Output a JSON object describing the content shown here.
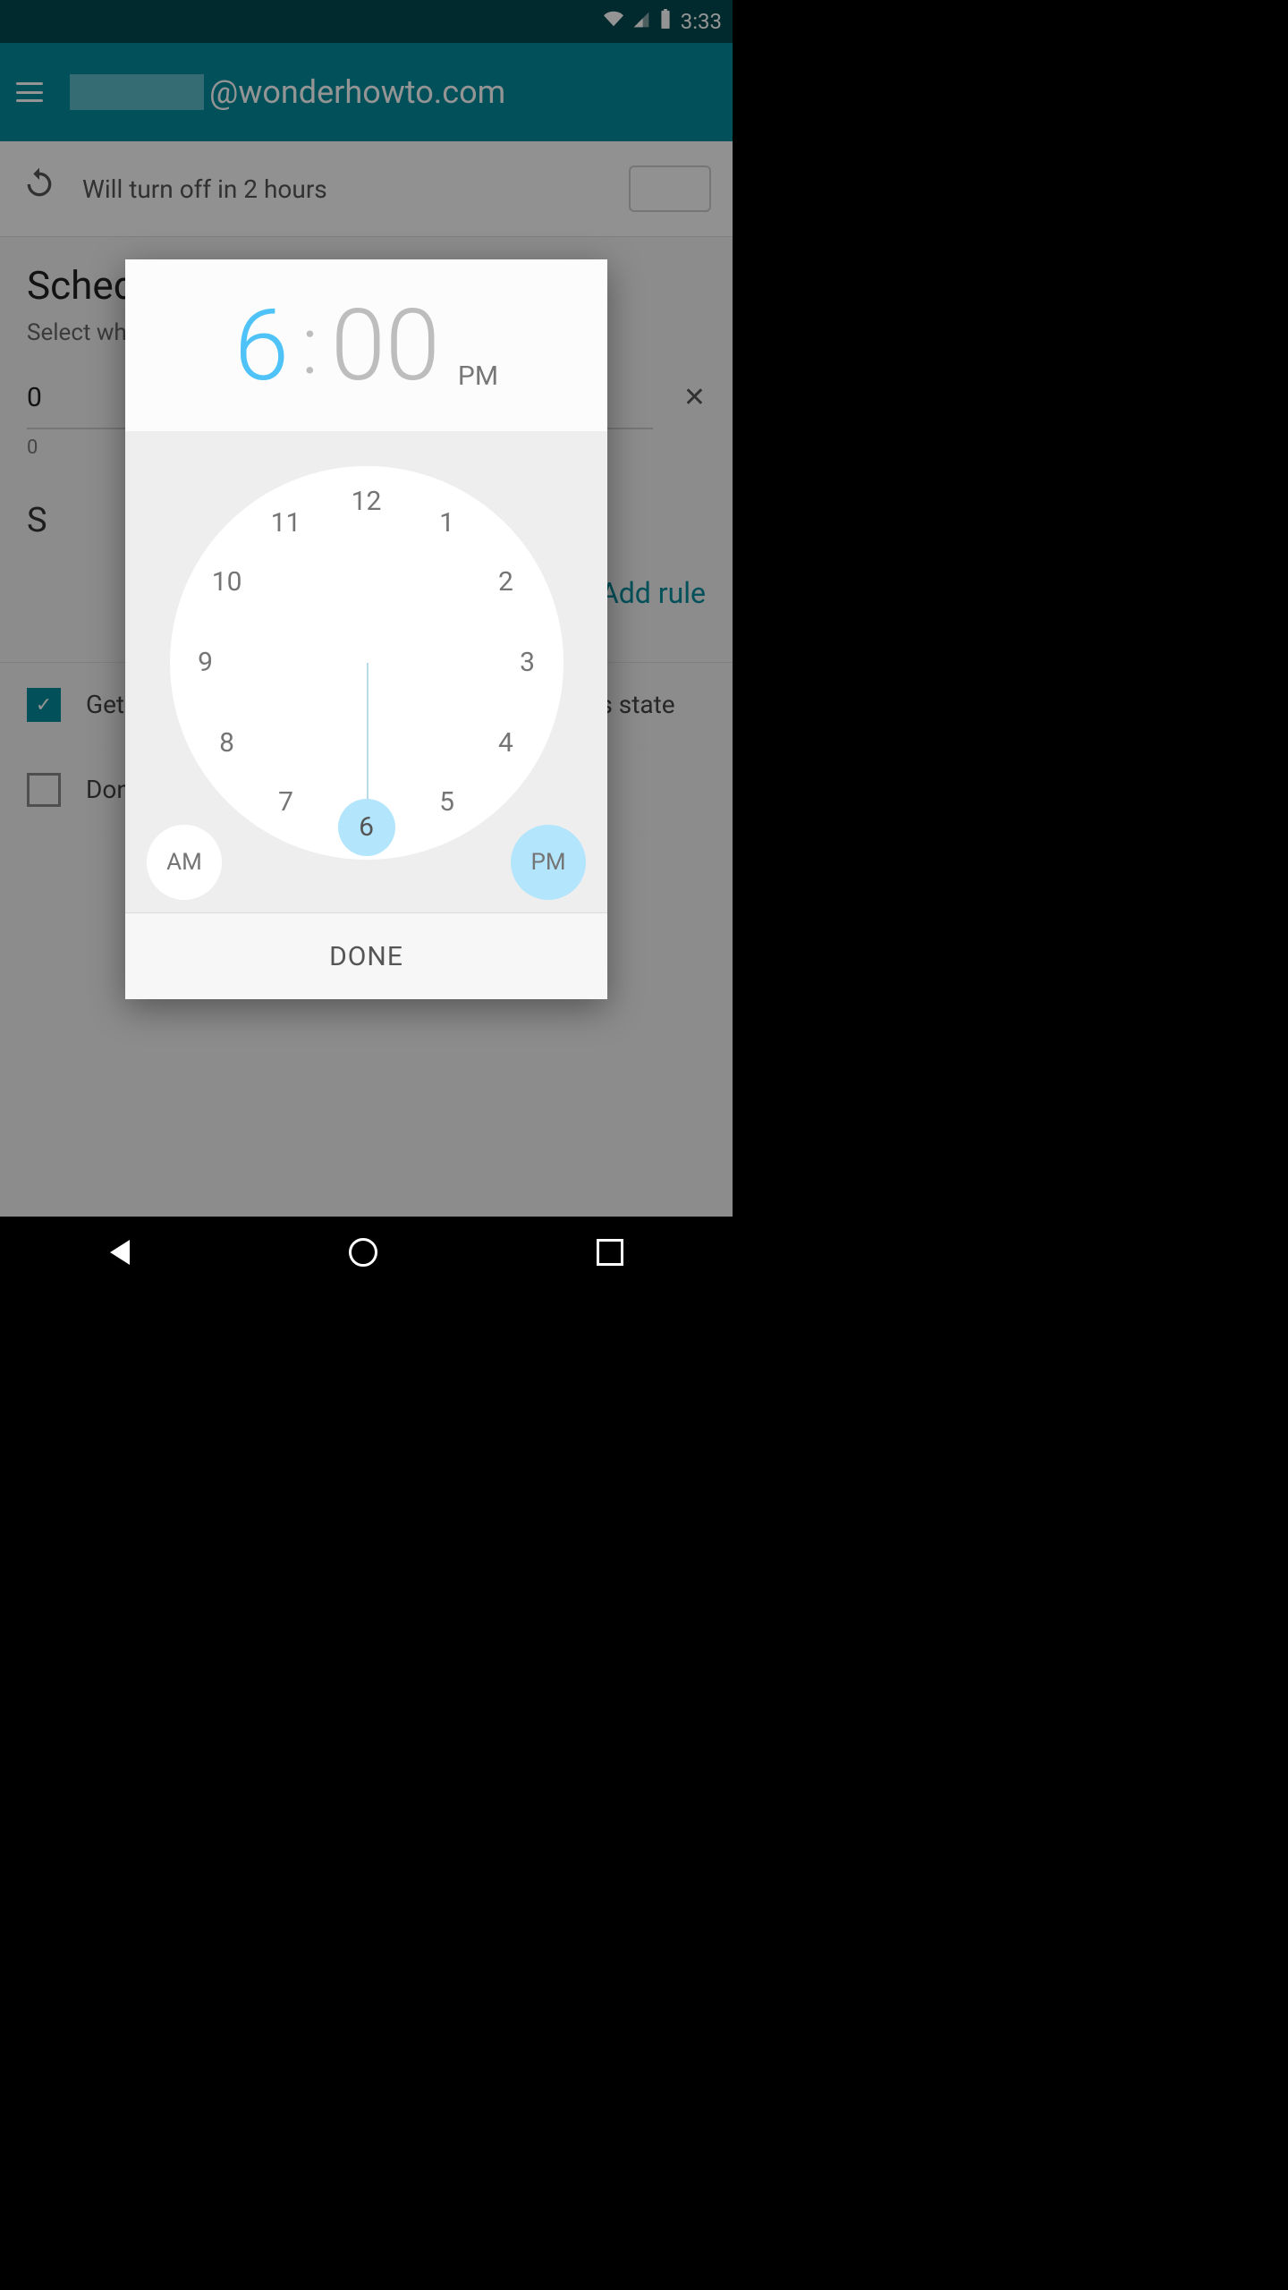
{
  "status": {
    "time": "3:33",
    "wifi": "wifi-icon",
    "signal": "signal-icon",
    "battery": "battery-icon"
  },
  "appbar": {
    "domain": "@wonderhowto.com"
  },
  "info": {
    "text": "Will turn off in 2 hours"
  },
  "page": {
    "heading": "Schedule",
    "subtitle": "Select what times to turn off automatically",
    "slider_value": "0",
    "slider_tick": "0",
    "day_label": "S",
    "add_rule": "Add rule"
  },
  "options": {
    "notify": {
      "label": "Get notifications when this account changes its state",
      "checked": true
    },
    "quiet": {
      "label": "Don't control this account with Quiet for Gmail",
      "checked": false
    }
  },
  "picker": {
    "hour": "6",
    "minute": "00",
    "ampm": "PM",
    "am_label": "AM",
    "pm_label": "PM",
    "done": "DONE",
    "hours": [
      "12",
      "1",
      "2",
      "3",
      "4",
      "5",
      "6",
      "7",
      "8",
      "9",
      "10",
      "11"
    ],
    "selected_hour": 6
  }
}
